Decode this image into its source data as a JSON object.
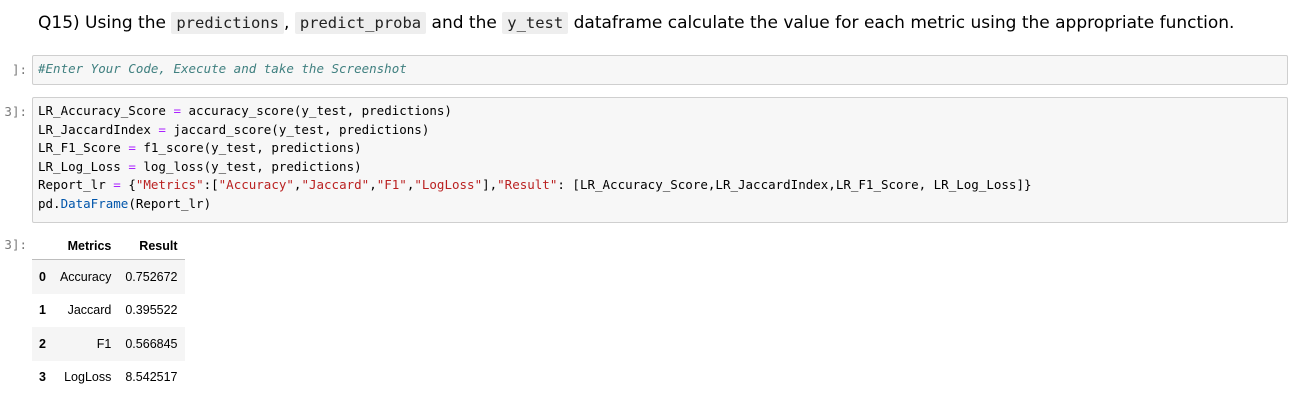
{
  "question": {
    "prefix": "Q15) Using the ",
    "code1": "predictions",
    "sep1": ", ",
    "code2": "predict_proba",
    "mid": " and the ",
    "code3": "y_test",
    "suffix": " dataframe calculate the value for each metric using the appropriate function."
  },
  "cell1": {
    "prompt": "]:",
    "comment": "#Enter Your Code, Execute and take the Screenshot"
  },
  "cell2": {
    "prompt": "3]:",
    "lines": [
      {
        "var": "LR_Accuracy_Score",
        "eq": "=",
        "rest": " accuracy_score(y_test, predictions)"
      },
      {
        "var": "LR_JaccardIndex",
        "eq": "=",
        "rest": " jaccard_score(y_test, predictions)"
      },
      {
        "var": "LR_F1_Score",
        "eq": "=",
        "rest": " f1_score(y_test, predictions)"
      },
      {
        "var": "LR_Log_Loss",
        "eq": "=",
        "rest": " log_loss(y_test, predictions)"
      }
    ],
    "report": {
      "var": "Report_lr",
      "eq": "=",
      "open": " {",
      "k1": "\"Metrics\"",
      "c1": ":[",
      "m1": "\"Accuracy\"",
      "m2": "\"Jaccard\"",
      "m3": "\"F1\"",
      "m4": "\"LogLoss\"",
      "c2": "],",
      "k2": "\"Result\"",
      "c3": ": [LR_Accuracy_Score,LR_JaccardIndex,LR_F1_Score, LR_Log_Loss]}"
    },
    "last": {
      "pd": "pd.",
      "fn": "DataFrame",
      "args": "(Report_lr)"
    }
  },
  "output": {
    "prompt": "3]:",
    "columns": [
      "",
      "Metrics",
      "Result"
    ],
    "rows": [
      {
        "index": "0",
        "metric": "Accuracy",
        "result": "0.752672"
      },
      {
        "index": "1",
        "metric": "Jaccard",
        "result": "0.395522"
      },
      {
        "index": "2",
        "metric": "F1",
        "result": "0.566845"
      },
      {
        "index": "3",
        "metric": "LogLoss",
        "result": "8.542517"
      }
    ]
  }
}
